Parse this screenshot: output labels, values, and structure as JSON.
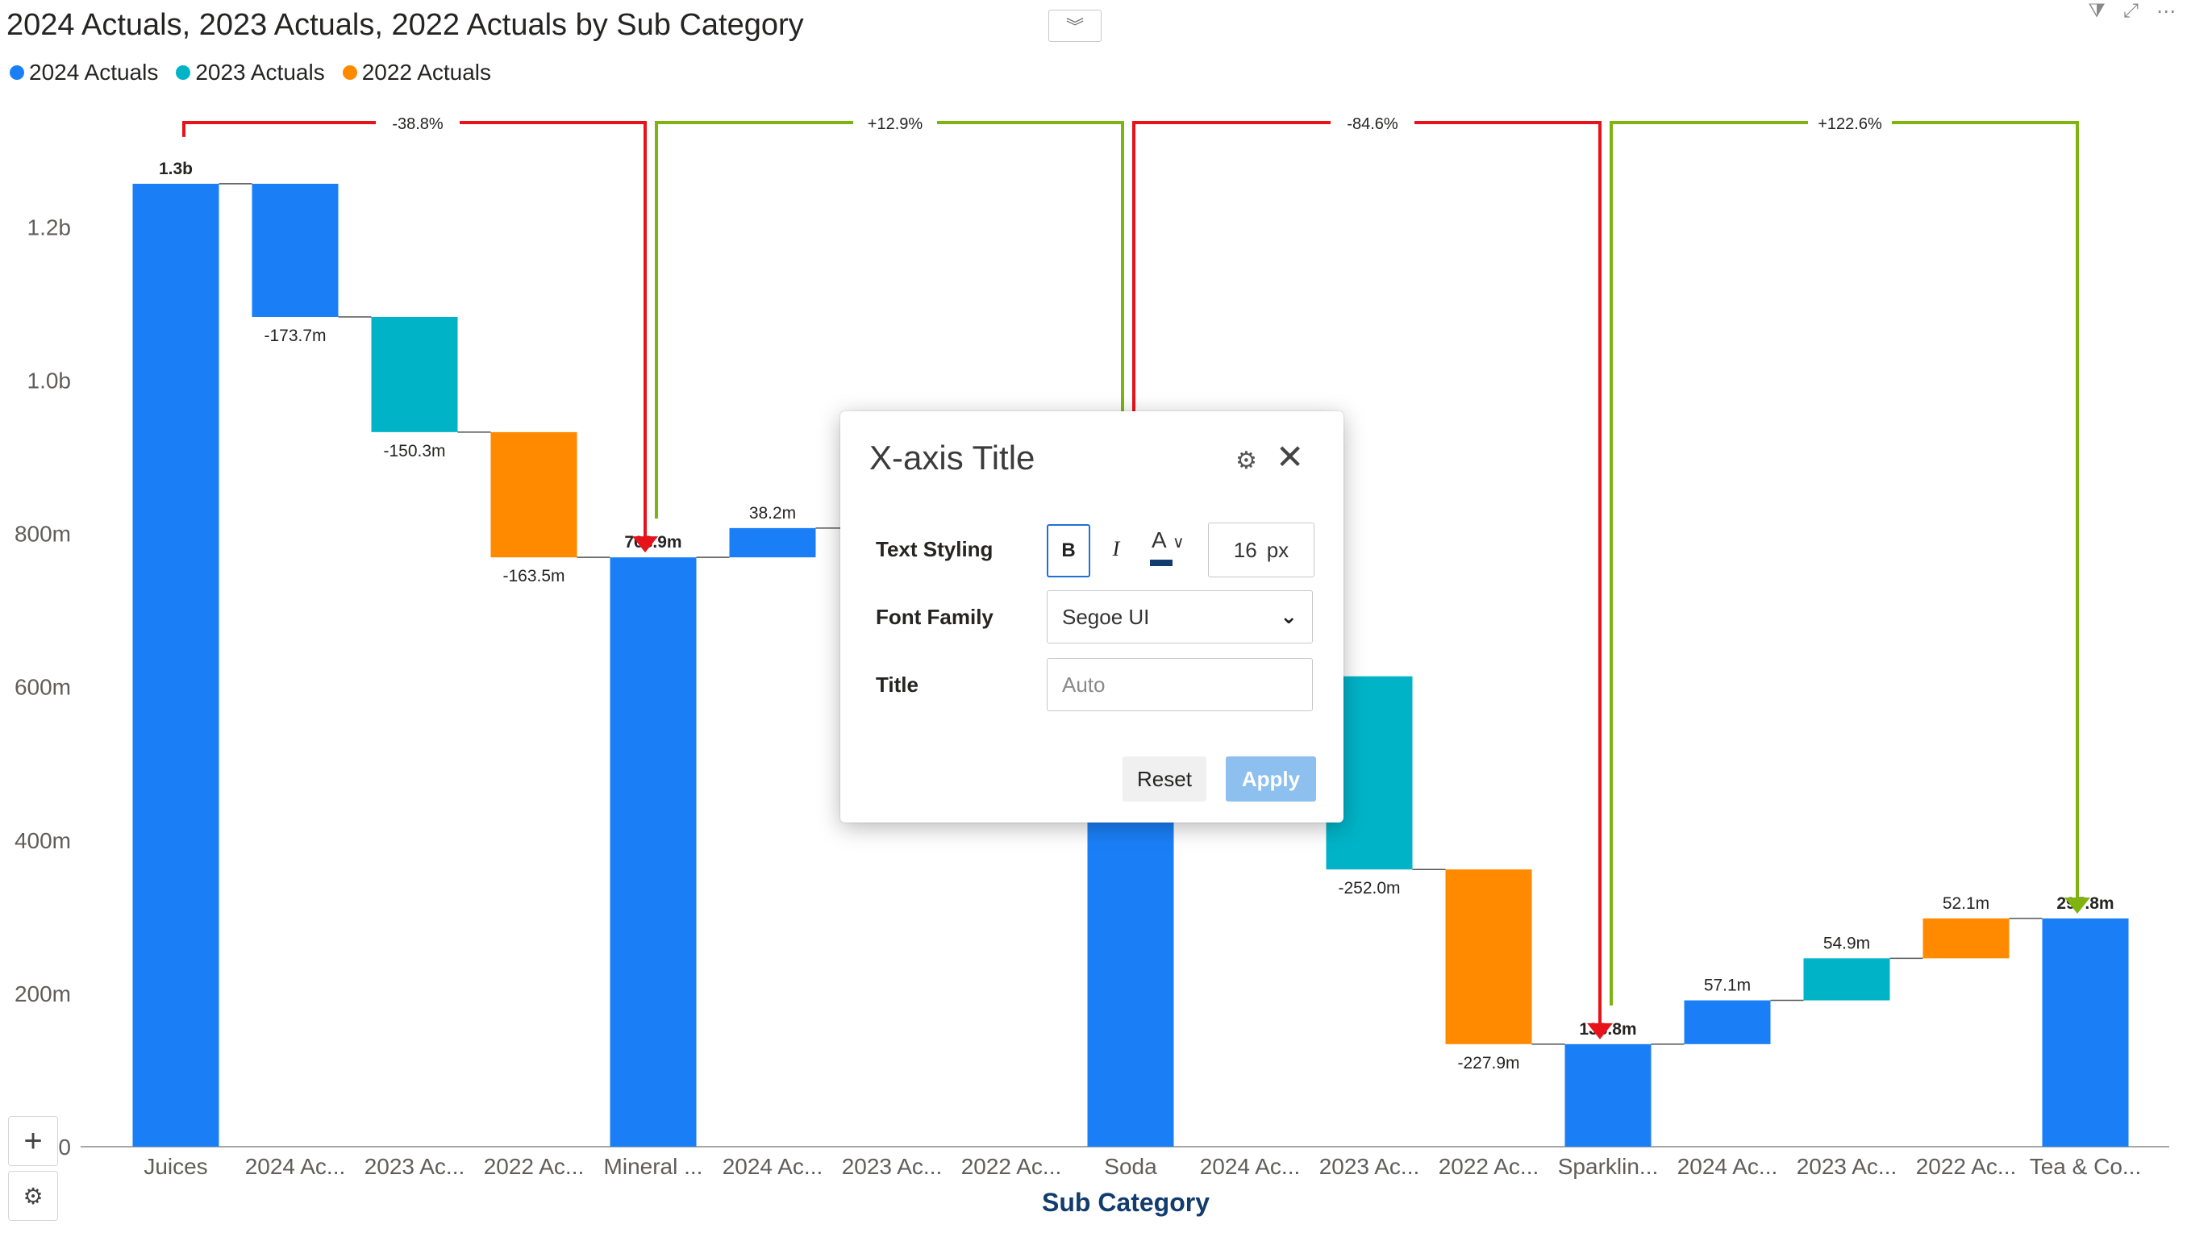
{
  "visual": {
    "title": "2024 Actuals, 2023 Actuals, 2022 Actuals by Sub Category",
    "collapse_icon": "double-chevron-down-icon",
    "toolbar_icons": [
      "filter-icon",
      "focus-mode-icon",
      "more-options-icon"
    ],
    "side_tools": [
      "plus-icon",
      "chart-settings-icon"
    ]
  },
  "legend": [
    {
      "label": "2024 Actuals",
      "color": "#1a7ff7"
    },
    {
      "label": "2023 Actuals",
      "color": "#00b3c7"
    },
    {
      "label": "2022 Actuals",
      "color": "#ff8a00"
    }
  ],
  "chart_data": {
    "type": "waterfall",
    "xlabel": "Sub Category",
    "ylabel": "",
    "ylim": [
      0,
      1400
    ],
    "y_ticks": [
      {
        "value": 0,
        "label": "0"
      },
      {
        "value": 200,
        "label": "200m"
      },
      {
        "value": 400,
        "label": "400m"
      },
      {
        "value": 600,
        "label": "600m"
      },
      {
        "value": 800,
        "label": "800m"
      },
      {
        "value": 1000,
        "label": "1.0b"
      },
      {
        "value": 1200,
        "label": "1.2b"
      }
    ],
    "categories": [
      "Juices",
      "2024 Ac...",
      "2023 Ac...",
      "2022 Ac...",
      "Mineral ...",
      "2024 Ac...",
      "2023 Ac...",
      "2022 Ac...",
      "Soda",
      "2024 Ac...",
      "2023 Ac...",
      "2022 Ac...",
      "Sparklin...",
      "2024 Ac...",
      "2023 Ac...",
      "2022 Ac...",
      "Tea & Co..."
    ],
    "bars": [
      {
        "kind": "total",
        "series": "2024 Actuals",
        "start": 0,
        "end": 1256.3,
        "label": "1.3b"
      },
      {
        "kind": "delta",
        "series": "2024 Actuals",
        "start": 1256.3,
        "end": 1082.6,
        "label": "-173.7m"
      },
      {
        "kind": "delta",
        "series": "2023 Actuals",
        "start": 1082.6,
        "end": 932.3,
        "label": "-150.3m"
      },
      {
        "kind": "delta",
        "series": "2022 Actuals",
        "start": 932.3,
        "end": 768.9,
        "label": "-163.5m"
      },
      {
        "kind": "total",
        "series": "2024 Actuals",
        "start": 0,
        "end": 768.9,
        "label": "768.9m"
      },
      {
        "kind": "delta",
        "series": "2024 Actuals",
        "start": 768.9,
        "end": 807.1,
        "label": "38.2m"
      },
      {
        "kind": "delta",
        "series": "2023 Actuals",
        "start": 807.1,
        "end": 807.1,
        "label": ""
      },
      {
        "kind": "delta",
        "series": "2022 Actuals",
        "start": 807.1,
        "end": 807.1,
        "label": ""
      },
      {
        "kind": "total",
        "series": "2024 Actuals",
        "start": 0,
        "end": 868.1,
        "label": ""
      },
      {
        "kind": "delta",
        "series": "2024 Actuals",
        "start": 868.1,
        "end": 613.7,
        "label": ""
      },
      {
        "kind": "delta",
        "series": "2023 Actuals",
        "start": 613.7,
        "end": 361.7,
        "label": "-252.0m"
      },
      {
        "kind": "delta",
        "series": "2022 Actuals",
        "start": 361.7,
        "end": 133.8,
        "label": "-227.9m"
      },
      {
        "kind": "total",
        "series": "2024 Actuals",
        "start": 0,
        "end": 133.8,
        "label": "133.8m"
      },
      {
        "kind": "delta",
        "series": "2024 Actuals",
        "start": 133.8,
        "end": 190.9,
        "label": "57.1m"
      },
      {
        "kind": "delta",
        "series": "2023 Actuals",
        "start": 190.9,
        "end": 245.8,
        "label": "54.9m"
      },
      {
        "kind": "delta",
        "series": "2022 Actuals",
        "start": 245.8,
        "end": 297.8,
        "label": "52.1m"
      },
      {
        "kind": "total",
        "series": "2024 Actuals",
        "start": 0,
        "end": 297.8,
        "label": "297.8m"
      }
    ],
    "comparisons": [
      {
        "from": 0,
        "to": 4,
        "label": "-38.8%",
        "color": "#e8121a"
      },
      {
        "from": 4,
        "to": 8,
        "label": "+12.9%",
        "color": "#7fb30f"
      },
      {
        "from": 8,
        "to": 12,
        "label": "-84.6%",
        "color": "#e8121a"
      },
      {
        "from": 12,
        "to": 16,
        "label": "+122.6%",
        "color": "#7fb30f"
      }
    ]
  },
  "dialog": {
    "title": "X-axis Title",
    "gear_icon": "gear-icon",
    "close_icon": "close-icon",
    "text_styling_label": "Text Styling",
    "bold_label": "B",
    "italic_label": "I",
    "color_label": "A",
    "color_value": "#123c6e",
    "font_size": "16",
    "font_size_unit": "px",
    "font_family_label": "Font Family",
    "font_family_value": "Segoe UI",
    "title_label": "Title",
    "title_placeholder": "Auto",
    "reset_label": "Reset",
    "apply_label": "Apply"
  }
}
